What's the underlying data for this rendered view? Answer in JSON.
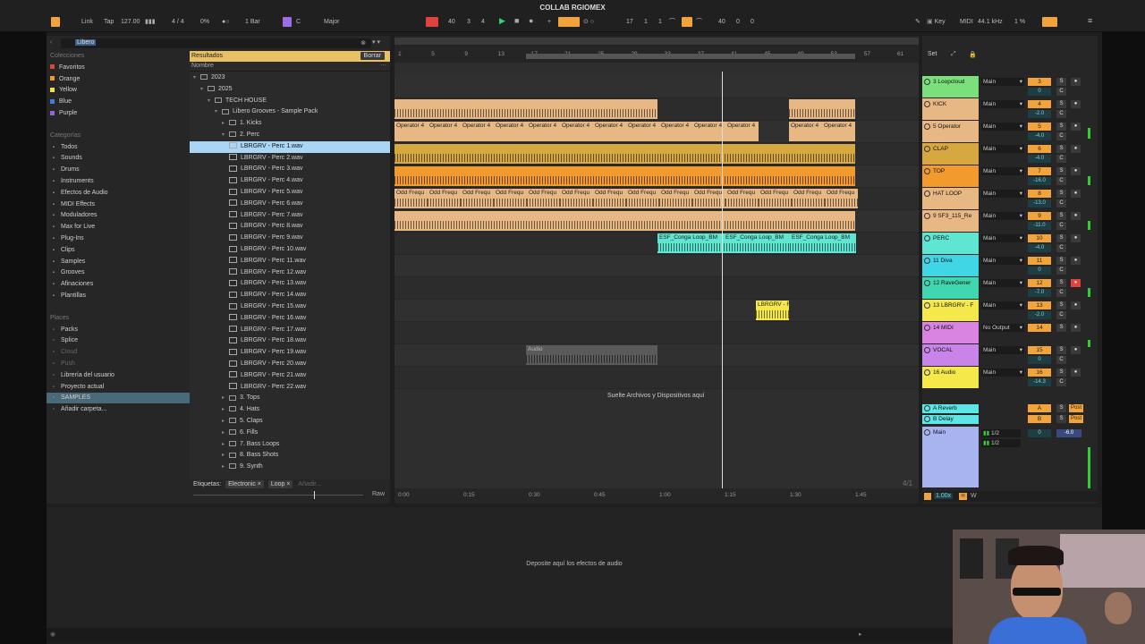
{
  "project_title": "COLLAB RGIOMEX",
  "transport": {
    "link": "Link",
    "tap": "Tap",
    "tempo": "127.00",
    "signature": "4 / 4",
    "percent": "0%",
    "quantize": "1 Bar",
    "key_root": "C",
    "scale": "Major",
    "position_bar": "40",
    "position_beat": "3",
    "position_sixteenth": "4",
    "loop_start_bar": "17",
    "loop_start_beat": "1",
    "loop_start_sixteenth": "1",
    "loop_len_bar": "40",
    "loop_len_beat": "0",
    "loop_len_sixteenth": "0",
    "key_label": "Key",
    "midi_label": "MIDI",
    "sample_rate": "44.1 kHz",
    "cpu": "1 %"
  },
  "browser": {
    "search_value": "Libero",
    "collections_header": "Colecciones",
    "collections": [
      {
        "label": "Favoritos",
        "color": "#e0433e"
      },
      {
        "label": "Orange",
        "color": "#f29a2e"
      },
      {
        "label": "Yellow",
        "color": "#f4e04a"
      },
      {
        "label": "Blue",
        "color": "#3d7fe0"
      },
      {
        "label": "Purple",
        "color": "#9b5de5"
      }
    ],
    "categories_header": "Categorías",
    "categories": [
      {
        "label": "Todos",
        "icon": "grid-icon"
      },
      {
        "label": "Sounds",
        "icon": "sound-icon"
      },
      {
        "label": "Drums",
        "icon": "drums-icon"
      },
      {
        "label": "Instruments",
        "icon": "instrument-icon"
      },
      {
        "label": "Efectos de Audio",
        "icon": "audio-effect-icon"
      },
      {
        "label": "MIDI Effects",
        "icon": "midi-effect-icon"
      },
      {
        "label": "Moduladores",
        "icon": "modulator-icon"
      },
      {
        "label": "Max for Live",
        "icon": "max-icon"
      },
      {
        "label": "Plug-Ins",
        "icon": "plugin-icon"
      },
      {
        "label": "Clips",
        "icon": "clip-icon"
      },
      {
        "label": "Samples",
        "icon": "sample-icon"
      },
      {
        "label": "Grooves",
        "icon": "groove-icon"
      },
      {
        "label": "Afinaciones",
        "icon": "tuning-icon"
      },
      {
        "label": "Plantillas",
        "icon": "template-icon"
      }
    ],
    "places_header": "Places",
    "places": [
      {
        "label": "Packs"
      },
      {
        "label": "Splice"
      },
      {
        "label": "Cloud"
      },
      {
        "label": "Push"
      },
      {
        "label": "Librería del usuario"
      },
      {
        "label": "Proyecto actual"
      },
      {
        "label": "SAMPLES"
      },
      {
        "label": "Añadir carpeta..."
      }
    ],
    "results_label": "Resultados",
    "clear_label": "Borrar",
    "name_col": "Nombre",
    "tree": [
      {
        "label": "2023",
        "type": "folder",
        "level": 0,
        "open": true
      },
      {
        "label": "2025",
        "type": "folder",
        "level": 1,
        "open": true
      },
      {
        "label": "TECH HOUSE",
        "type": "folder",
        "level": 2,
        "open": true
      },
      {
        "label": "Libero Grooves - Sample Pack",
        "type": "folder",
        "level": 3,
        "open": true
      },
      {
        "label": "1. Kicks",
        "type": "folder",
        "level": 4,
        "open": false
      },
      {
        "label": "2. Perc",
        "type": "folder",
        "level": 4,
        "open": true
      },
      {
        "label": "LBRGRV - Perc 1.wav",
        "type": "file",
        "level": 5,
        "selected": true
      },
      {
        "label": "LBRGRV - Perc 2.wav",
        "type": "file",
        "level": 5
      },
      {
        "label": "LBRGRV - Perc 3.wav",
        "type": "file",
        "level": 5
      },
      {
        "label": "LBRGRV - Perc 4.wav",
        "type": "file",
        "level": 5
      },
      {
        "label": "LBRGRV - Perc 5.wav",
        "type": "file",
        "level": 5
      },
      {
        "label": "LBRGRV - Perc 6.wav",
        "type": "file",
        "level": 5
      },
      {
        "label": "LBRGRV - Perc 7.wav",
        "type": "file",
        "level": 5
      },
      {
        "label": "LBRGRV - Perc 8.wav",
        "type": "file",
        "level": 5
      },
      {
        "label": "LBRGRV - Perc 9.wav",
        "type": "file",
        "level": 5
      },
      {
        "label": "LBRGRV - Perc 10.wav",
        "type": "file",
        "level": 5
      },
      {
        "label": "LBRGRV - Perc 11.wav",
        "type": "file",
        "level": 5
      },
      {
        "label": "LBRGRV - Perc 12.wav",
        "type": "file",
        "level": 5
      },
      {
        "label": "LBRGRV - Perc 13.wav",
        "type": "file",
        "level": 5
      },
      {
        "label": "LBRGRV - Perc 14.wav",
        "type": "file",
        "level": 5
      },
      {
        "label": "LBRGRV - Perc 15.wav",
        "type": "file",
        "level": 5
      },
      {
        "label": "LBRGRV - Perc 16.wav",
        "type": "file",
        "level": 5
      },
      {
        "label": "LBRGRV - Perc 17.wav",
        "type": "file",
        "level": 5
      },
      {
        "label": "LBRGRV - Perc 18.wav",
        "type": "file",
        "level": 5
      },
      {
        "label": "LBRGRV - Perc 19.wav",
        "type": "file",
        "level": 5
      },
      {
        "label": "LBRGRV - Perc 20.wav",
        "type": "file",
        "level": 5
      },
      {
        "label": "LBRGRV - Perc 21.wav",
        "type": "file",
        "level": 5
      },
      {
        "label": "LBRGRV - Perc 22.wav",
        "type": "file",
        "level": 5
      },
      {
        "label": "3. Tops",
        "type": "folder",
        "level": 4,
        "open": false
      },
      {
        "label": "4. Hats",
        "type": "folder",
        "level": 4,
        "open": false
      },
      {
        "label": "5. Claps",
        "type": "folder",
        "level": 4,
        "open": false
      },
      {
        "label": "6. Fills",
        "type": "folder",
        "level": 4,
        "open": false
      },
      {
        "label": "7. Bass Loops",
        "type": "folder",
        "level": 4,
        "open": false
      },
      {
        "label": "8. Bass Shots",
        "type": "folder",
        "level": 4,
        "open": false
      },
      {
        "label": "9. Synth",
        "type": "folder",
        "level": 4,
        "open": false
      }
    ],
    "tags_label": "Etiquetas:",
    "tags": [
      "Electronic",
      "Loop"
    ],
    "tags_add_placeholder": "Añadir...",
    "raw_label": "Raw"
  },
  "arrangement": {
    "bar_ticks": [
      "1",
      "5",
      "9",
      "13",
      "17",
      "21",
      "25",
      "29",
      "33",
      "37",
      "41",
      "45",
      "49",
      "53",
      "57",
      "61"
    ],
    "time_ticks": [
      "0:00",
      "0:15",
      "0:30",
      "0:45",
      "1:00",
      "1:15",
      "1:30",
      "1:45"
    ],
    "operator_label": "Operator 4",
    "odd_label": "Odd Frequ",
    "conga_label": "ESF_Conga Loop_BM",
    "perc_clip_label": "LBRGRV - F",
    "audio_clip_label": "Audio",
    "drop_hint": "Suelte Archivos y Dispositivos aquí",
    "page_indicator": "4/1"
  },
  "mixer": {
    "set_label": "Set",
    "tracks": [
      {
        "name": "3 Loopcloud",
        "color": "#7be07b",
        "io": "Main",
        "num": "3",
        "vol": "0"
      },
      {
        "name": "KICK",
        "color": "#e8b884",
        "io": "Main",
        "num": "4",
        "vol": "-2.0"
      },
      {
        "name": "5 Operator",
        "color": "#e8b884",
        "io": "Main",
        "num": "5",
        "vol": "-4.0"
      },
      {
        "name": "CLAP",
        "color": "#d8a840",
        "io": "Main",
        "num": "6",
        "vol": "-4.0"
      },
      {
        "name": "TOP",
        "color": "#f29a2e",
        "io": "Main",
        "num": "7",
        "vol": "-16.0"
      },
      {
        "name": "HAT LOOP",
        "color": "#e8b884",
        "io": "Main",
        "num": "8",
        "vol": "-13.0"
      },
      {
        "name": "9 SF3_115_Re",
        "color": "#e8b884",
        "io": "Main",
        "num": "9",
        "vol": "-11.0"
      },
      {
        "name": "PERC",
        "color": "#5ee6d2",
        "io": "Main",
        "num": "10",
        "vol": "-4.0"
      },
      {
        "name": "11 Diva",
        "color": "#3fd6e6",
        "io": "Main",
        "num": "11",
        "vol": "0"
      },
      {
        "name": "12 RaveGener",
        "color": "#3fd6b0",
        "io": "Main",
        "num": "12",
        "vol": "-7.0"
      },
      {
        "name": "13 LBRGRV - F",
        "color": "#f4e84a",
        "io": "Main",
        "num": "13",
        "vol": "-2.0"
      },
      {
        "name": "14 MIDI",
        "color": "#d884e0",
        "io": "No Output",
        "num": "14",
        "vol": ""
      },
      {
        "name": "VOCAL",
        "color": "#c884e8",
        "io": "Main",
        "num": "15",
        "vol": "0"
      },
      {
        "name": "16 Audio",
        "color": "#f4e84a",
        "io": "Main",
        "num": "16",
        "vol": "-14.3"
      }
    ],
    "returns": [
      {
        "name": "A Reverb",
        "color": "#5ee6e6",
        "num": "A",
        "post": "Post"
      },
      {
        "name": "B Delay",
        "color": "#5ee6e6",
        "num": "B",
        "post": "Post"
      }
    ],
    "main_name": "Main",
    "main_sel1": "1/2",
    "main_sel2": "1/2",
    "main_vol": "0",
    "main_vol2": "-6.0",
    "zoom": "1.00x"
  },
  "device_area": {
    "drop_hint": "Deposite aquí los efectos de audio"
  }
}
